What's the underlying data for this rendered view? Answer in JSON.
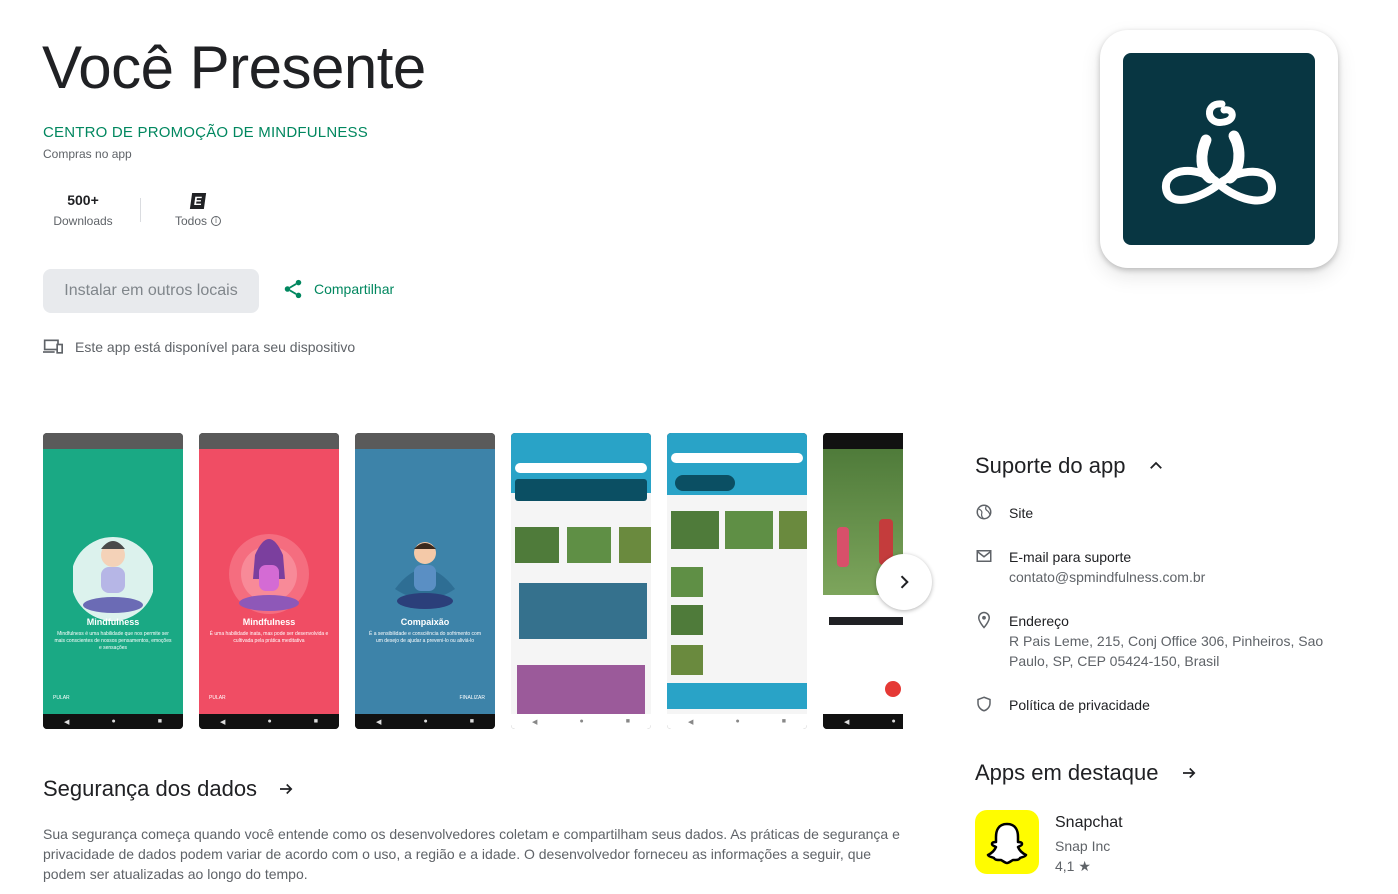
{
  "app": {
    "title": "Você Presente",
    "developer": "CENTRO DE PROMOÇÃO DE MINDFULNESS",
    "in_app_purchases": "Compras no app",
    "stats": {
      "downloads_value": "500+",
      "downloads_label": "Downloads",
      "rating_badge": "E",
      "rating_label": "Todos"
    },
    "install_label": "Instalar em outros locais",
    "share_label": "Compartilhar",
    "availability": "Este app está disponível para seu dispositivo",
    "icon": "meditation-figure-icon",
    "icon_bg": "#083642"
  },
  "screenshots": [
    {
      "bg": "#1aa984",
      "title": "Mindfulness",
      "text": "Mindfulness é uma habilidade que nos permite ser mais conscientes de nossos pensamentos, emoções e sensações",
      "left": "PULAR",
      "right": ""
    },
    {
      "bg": "#f04d64",
      "title": "Mindfulness",
      "text": "É uma habilidade inata, mas pode ser desenvolvida e cultivada pela prática meditativa",
      "left": "PULAR",
      "right": ""
    },
    {
      "bg": "#3d83a9",
      "title": "Compaixão",
      "text": "É a sensibilidade e consciência do sofrimento com um desejo de ajudar a preveni-lo ou aliviá-lo",
      "left": "",
      "right": "FINALIZAR"
    },
    {
      "bg": "#f2f2f2",
      "title": "",
      "text": "",
      "left": "",
      "right": ""
    },
    {
      "bg": "#f2f2f2",
      "title": "",
      "text": "",
      "left": "",
      "right": ""
    },
    {
      "bg": "#3e6b3a",
      "title": "",
      "text": "",
      "left": "",
      "right": ""
    }
  ],
  "data_safety": {
    "heading": "Segurança dos dados",
    "text": "Sua segurança começa quando você entende como os desenvolvedores coletam e compartilham seus dados. As práticas de segurança e privacidade de dados podem variar de acordo com o uso, a região e a idade. O desenvolvedor forneceu as informações a seguir, que podem ser atualizadas ao longo do tempo."
  },
  "support": {
    "heading": "Suporte do app",
    "site_label": "Site",
    "email_label": "E-mail para suporte",
    "email_value": "contato@spmindfulness.com.br",
    "address_label": "Endereço",
    "address_value": "R Pais Leme, 215, Conj Office 306, Pinheiros, Sao Paulo, SP, CEP 05424-150, Brasil",
    "privacy_label": "Política de privacidade"
  },
  "featured": {
    "heading": "Apps em destaque",
    "app_name": "Snapchat",
    "app_company": "Snap Inc",
    "app_rating": "4,1 ★",
    "app_icon": "snapchat-ghost-icon",
    "app_icon_bg": "#fffc00"
  },
  "colors": {
    "accent": "#01875f",
    "text_primary": "#202124",
    "text_secondary": "#5f6368"
  }
}
